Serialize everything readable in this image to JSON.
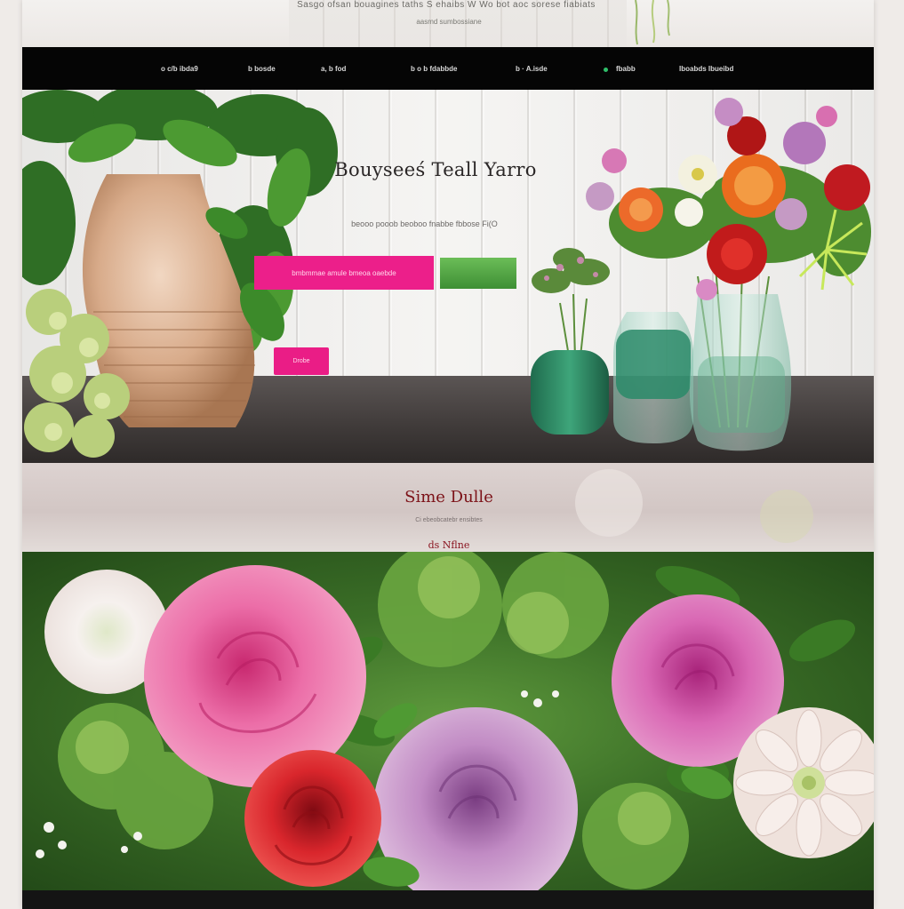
{
  "header": {
    "tagline": "Sasgo ofsan bouagines taths S ehaibs W  Wo bot aoc sorese fiabiats",
    "subline": "aasmd sumbossiane"
  },
  "nav": {
    "items": [
      {
        "label": "o c/b ibda9"
      },
      {
        "label": "b bosde"
      },
      {
        "label": "a, b fod"
      },
      {
        "label": "b o b fdabbde"
      },
      {
        "label": "b · A.isde"
      },
      {
        "label": "fbabb"
      },
      {
        "label": "Iboabds Ibueibd"
      }
    ],
    "active_color": "#2fbf6a"
  },
  "hero": {
    "title": "Bouyseeś Teall Yarro",
    "subtitle": "beooo  pooob  beoboo fnabbe  fbbose Fi(O",
    "primary_button": "bmbmmae amule  bmeoa oaebde",
    "small_button": "Drobe"
  },
  "section": {
    "title": "Sime Dulle",
    "subtitle": "Ci ebeobcatebr ensibtes",
    "link": "ds Nflne"
  },
  "colors": {
    "accent": "#ec1f8a",
    "nav_bg": "#050505",
    "heading_red": "#7c1218",
    "leaf_green": "#3b6f27"
  }
}
